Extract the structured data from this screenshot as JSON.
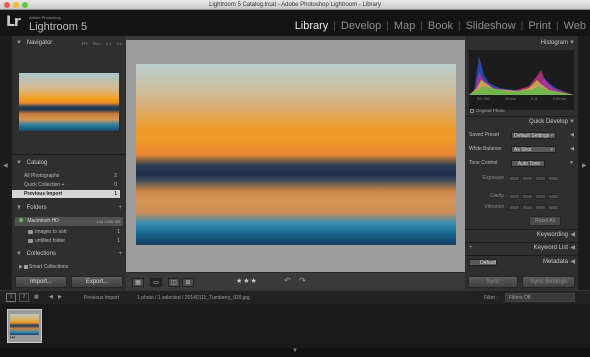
{
  "window": {
    "title": "Lightroom 5 Catalog.lrcat - Adobe Photoshop Lightroom - Library"
  },
  "app": {
    "logo": "Lr",
    "subtitle": "Adobe Photoshop",
    "name": "Lightroom 5"
  },
  "modules": [
    {
      "label": "Library",
      "active": true
    },
    {
      "label": "Develop"
    },
    {
      "label": "Map"
    },
    {
      "label": "Book"
    },
    {
      "label": "Slideshow"
    },
    {
      "label": "Print"
    },
    {
      "label": "Web"
    }
  ],
  "navigator": {
    "title": "Navigator",
    "zoom_options": [
      "FIT",
      "FILL",
      "1:1",
      "3:1"
    ]
  },
  "catalog": {
    "title": "Catalog",
    "items": [
      {
        "label": "All Photographs",
        "count": "2"
      },
      {
        "label": "Quick Collection +",
        "count": "0"
      },
      {
        "label": "Previous Import",
        "count": "1",
        "selected": true
      }
    ]
  },
  "folders": {
    "title": "Folders",
    "volume": {
      "label": "Macintosh HD",
      "capacity": "144 / 465 GB"
    },
    "items": [
      {
        "label": "Images to sort",
        "count": "1"
      },
      {
        "label": "untitled folder",
        "count": "1"
      }
    ]
  },
  "collections": {
    "title": "Collections",
    "items": [
      {
        "label": "Smart Collections"
      }
    ]
  },
  "left_buttons": {
    "import": "Import...",
    "export": "Export..."
  },
  "histogram": {
    "title": "Histogram",
    "meta": [
      "ISO 200",
      "25 mm",
      "f/ 11",
      "0.50 sec"
    ],
    "original_photo": "Original Photo"
  },
  "quick_develop": {
    "title": "Quick Develop",
    "saved_preset": {
      "label": "Saved Preset",
      "value": "Default Settings"
    },
    "white_balance": {
      "label": "White Balance",
      "value": "As Shot"
    },
    "tone_control": {
      "label": "Tone Control",
      "value": "Auto Tone"
    },
    "adjustments": [
      "Exposure",
      "Clarity",
      "Vibrance"
    ],
    "reset": "Reset All"
  },
  "keywording": {
    "title": "Keywording"
  },
  "keyword_list": {
    "title": "Keyword List"
  },
  "metadata": {
    "title": "Metadata",
    "preset": "Default"
  },
  "right_buttons": {
    "sync": "Sync",
    "sync_settings": "Sync Settings"
  },
  "toolbar": {
    "rating": "★★★"
  },
  "filmstrip_bar": {
    "page1": "1",
    "page2": "2",
    "source": "Previous Import",
    "status": "1 photo / 1 selected / 20140111_Tumberry_020.jpg",
    "filter_label": "Filter :",
    "filter_value": "Filters Off"
  },
  "filmstrip": {
    "thumb_dots": "•••"
  },
  "colors": {
    "panel": "#2f2f2f",
    "center_bg": "#9d9d9d",
    "active_module": "#eaeaea",
    "inactive_module": "#8d8d8d"
  }
}
